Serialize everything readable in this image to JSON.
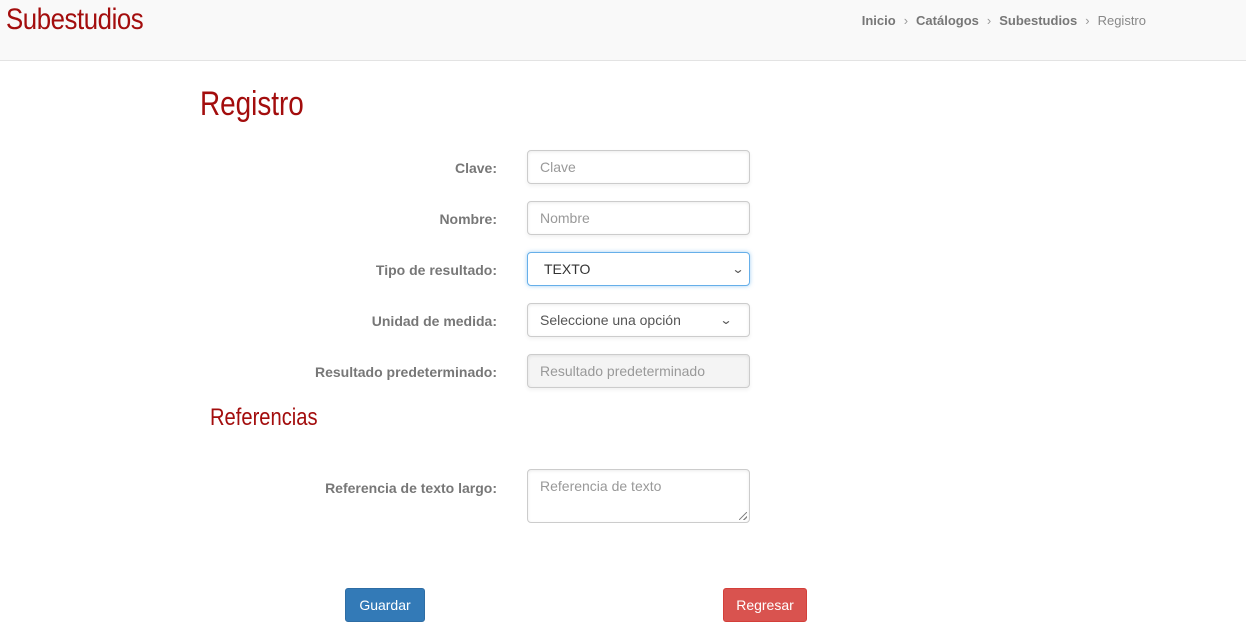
{
  "header": {
    "app_title": "Subestudios",
    "breadcrumb": [
      {
        "label": "Inicio"
      },
      {
        "label": "Catálogos"
      },
      {
        "label": "Subestudios"
      },
      {
        "label": "Registro"
      }
    ]
  },
  "main": {
    "page_title": "Registro",
    "form": {
      "clave": {
        "label": "Clave:",
        "placeholder": "Clave"
      },
      "nombre": {
        "label": "Nombre:",
        "placeholder": "Nombre"
      },
      "tipo_resultado": {
        "label": "Tipo de resultado:",
        "selected": "TEXTO"
      },
      "unidad_medida": {
        "label": "Unidad de medida:",
        "selected": "Seleccione una opción"
      },
      "resultado_predeterminado": {
        "label": "Resultado predeterminado:",
        "placeholder": "Resultado predeterminado"
      }
    },
    "referencias": {
      "title": "Referencias",
      "texto_largo": {
        "label": "Referencia de texto largo:",
        "placeholder": "Referencia de texto"
      }
    },
    "actions": {
      "save_label": "Guardar",
      "back_label": "Regresar"
    }
  },
  "colors": {
    "brand_red": "#a30d0d",
    "primary_blue": "#337ab7",
    "danger_red": "#d9534f"
  }
}
